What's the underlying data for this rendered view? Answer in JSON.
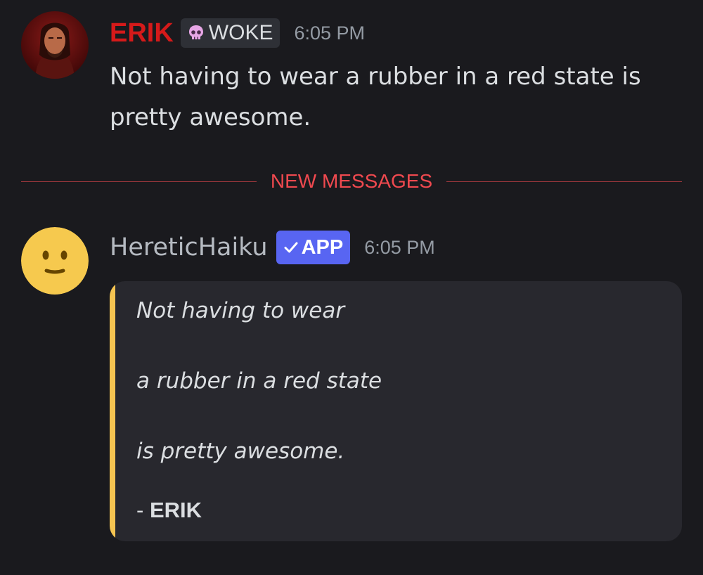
{
  "messages": [
    {
      "author": "ERIK",
      "author_color": "#d51a1a",
      "role_badge": {
        "icon": "skull-icon",
        "label": "WOKE"
      },
      "timestamp": "6:05 PM",
      "text": "Not having to wear a rubber in a red state is pretty awesome."
    },
    {
      "author": "HereticHaiku",
      "app_badge": {
        "icon": "checkmark-icon",
        "label": "APP",
        "color": "#5865f2"
      },
      "timestamp": "6:05 PM",
      "embed": {
        "accent_color": "#f5c451",
        "lines": [
          "Not having to wear",
          "a rubber in a red state",
          "is pretty awesome."
        ],
        "signature_prefix": "- ",
        "signature_name": "ERIK"
      }
    }
  ],
  "divider": {
    "label": "NEW MESSAGES",
    "color": "#f0494f"
  },
  "avatars": {
    "erik": "avatar-portrait-icon",
    "bot": "slightly-smiling-face-icon"
  }
}
